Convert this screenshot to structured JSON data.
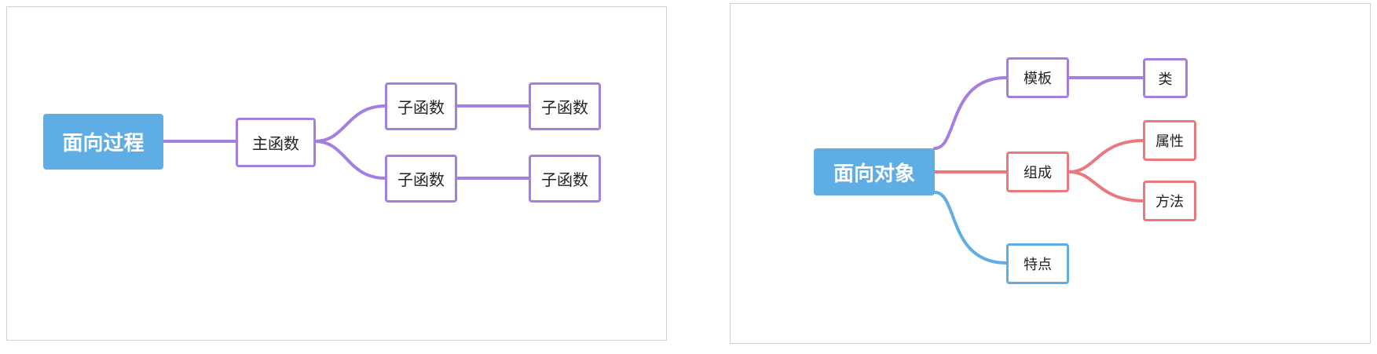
{
  "colors": {
    "root_fill": "#5eaee5",
    "branch_purple": "#a47fe0",
    "branch_red": "#e8797f",
    "branch_blue": "#5eaee5"
  },
  "procedural": {
    "root": "面向过程",
    "main": "主函数",
    "children": [
      {
        "label": "子函数",
        "child": "子函数"
      },
      {
        "label": "子函数",
        "child": "子函数"
      }
    ]
  },
  "object_oriented": {
    "root": "面向对象",
    "branches": [
      {
        "label": "模板",
        "color": "purple",
        "children": [
          "类"
        ]
      },
      {
        "label": "组成",
        "color": "red",
        "children": [
          "属性",
          "方法"
        ]
      },
      {
        "label": "特点",
        "color": "blue",
        "children": []
      }
    ]
  }
}
